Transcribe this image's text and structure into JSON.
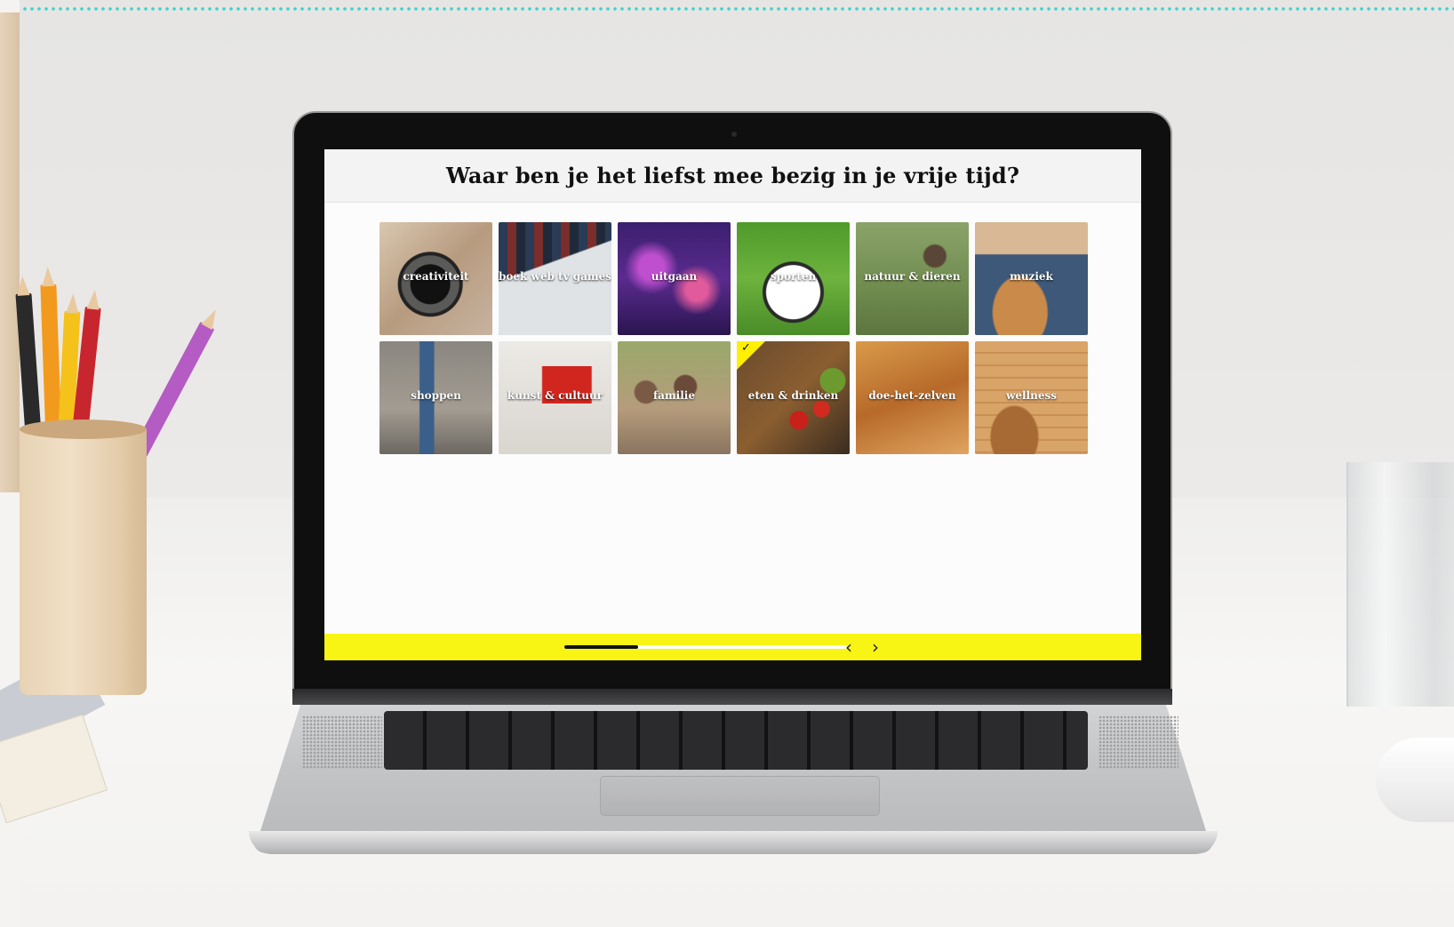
{
  "quiz": {
    "question": "Waar ben je het liefst mee bezig in je vrije tijd?",
    "categories": [
      {
        "label": "creativiteit",
        "selected": false
      },
      {
        "label": "boek web tv games",
        "selected": false
      },
      {
        "label": "uitgaan",
        "selected": false
      },
      {
        "label": "sporten",
        "selected": false
      },
      {
        "label": "natuur & dieren",
        "selected": false
      },
      {
        "label": "muziek",
        "selected": false
      },
      {
        "label": "shoppen",
        "selected": false
      },
      {
        "label": "kunst & cultuur",
        "selected": false
      },
      {
        "label": "familie",
        "selected": false
      },
      {
        "label": "eten & drinken",
        "selected": true
      },
      {
        "label": "doe-het-zelven",
        "selected": false
      },
      {
        "label": "wellness",
        "selected": false
      }
    ],
    "progress_fraction": 0.26,
    "prev_icon": "chevron-left-icon",
    "next_icon": "chevron-right-icon",
    "prev_glyph": "‹",
    "next_glyph": "›",
    "check_glyph": "✓"
  },
  "colors": {
    "accent_yellow": "#f8f414",
    "top_dots": "#35d6cc"
  }
}
